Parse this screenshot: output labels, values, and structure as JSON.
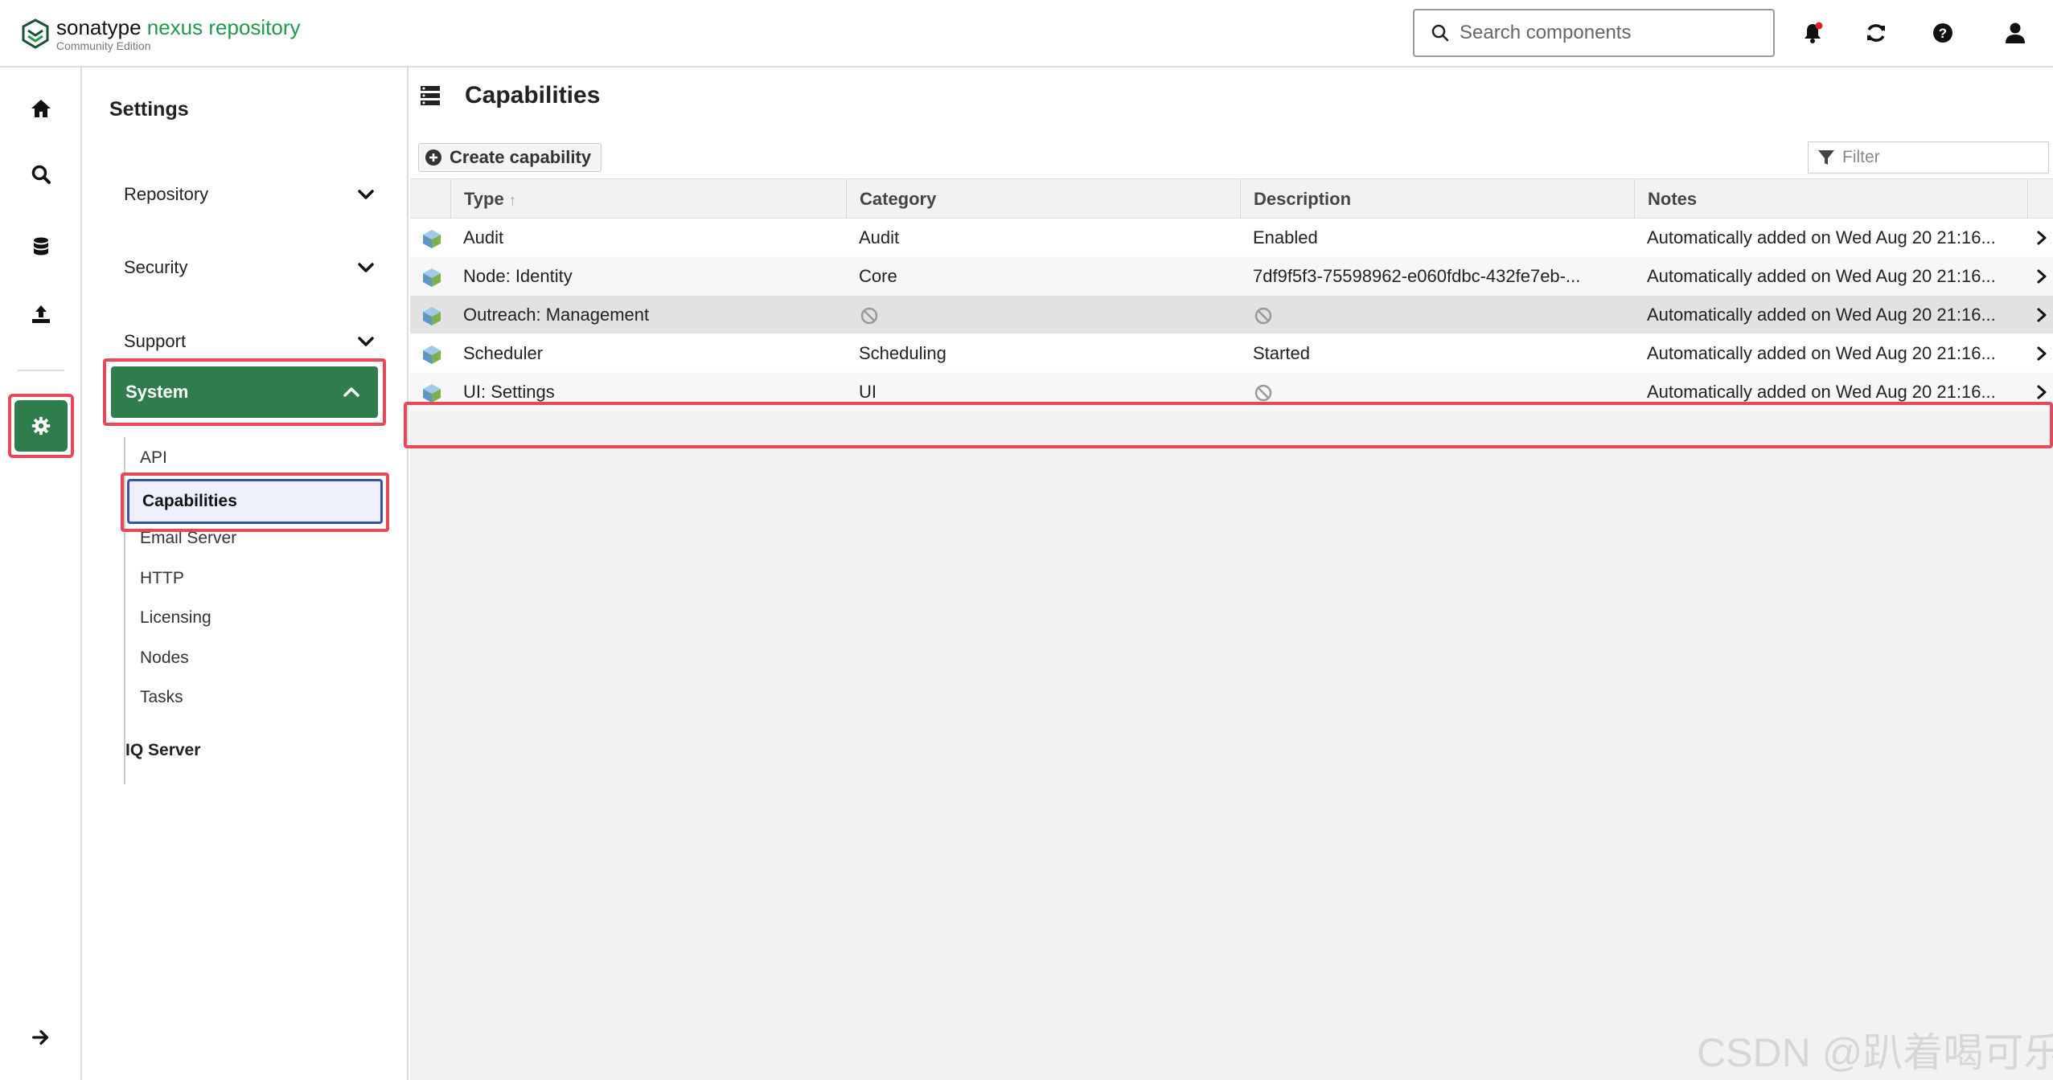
{
  "brand": {
    "name_part1": "sonatype",
    "name_part2": "nexus repository",
    "edition": "Community Edition"
  },
  "header": {
    "search_placeholder": "Search components"
  },
  "settings_nav": {
    "title": "Settings",
    "groups": [
      {
        "label": "Repository"
      },
      {
        "label": "Security"
      },
      {
        "label": "Support"
      }
    ],
    "system": {
      "label": "System",
      "items": [
        "API",
        "Capabilities",
        "Email Server",
        "HTTP",
        "Licensing",
        "Nodes",
        "Tasks"
      ],
      "selected": "Capabilities"
    },
    "iq_server": "IQ Server"
  },
  "main": {
    "title": "Capabilities",
    "create_button": "Create capability",
    "filter_placeholder": "Filter",
    "columns": [
      "Type",
      "Category",
      "Description",
      "Notes"
    ],
    "sort_indicator": "↑",
    "rows": [
      {
        "type": "Audit",
        "category": "Audit",
        "description": "Enabled",
        "notes": "Automatically added on Wed Aug 20 21:16..."
      },
      {
        "type": "Node: Identity",
        "category": "Core",
        "description": "7df9f5f3-75598962-e060fdbc-432fe7eb-...",
        "notes": "Automatically added on Wed Aug 20 21:16..."
      },
      {
        "type": "Outreach: Management",
        "category": "",
        "description": "",
        "notes": "Automatically added on Wed Aug 20 21:16..."
      },
      {
        "type": "Scheduler",
        "category": "Scheduling",
        "description": "Started",
        "notes": "Automatically added on Wed Aug 20 21:16..."
      },
      {
        "type": "UI: Settings",
        "category": "UI",
        "description": "",
        "notes": "Automatically added on Wed Aug 20 21:16..."
      }
    ]
  },
  "watermark": "CSDN @趴着喝可乐",
  "colors": {
    "brand_green": "#1f9a4d",
    "active_green": "#2f7d4d",
    "highlight_red": "#e8485c",
    "selected_blue": "#3553a9"
  }
}
